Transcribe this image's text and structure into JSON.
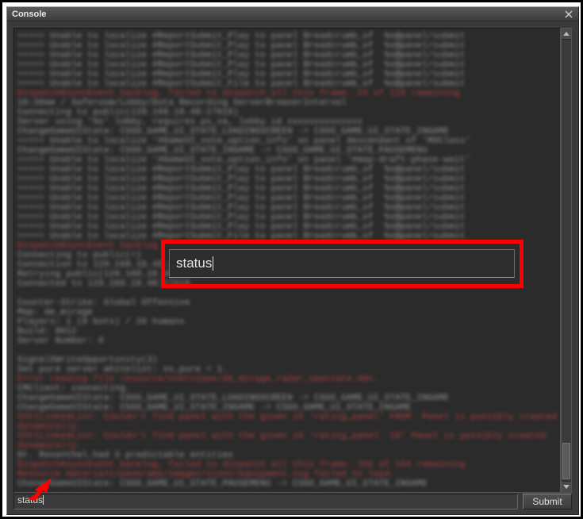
{
  "window": {
    "title": "Console",
    "close_label": "×"
  },
  "highlight": {
    "text": "status"
  },
  "input": {
    "value": "status"
  },
  "submit": {
    "label": "Submit"
  },
  "colors": {
    "highlight_border": "#ff0000",
    "arrow": "#ff0000"
  },
  "log": {
    "lines": [
      {
        "c": "g",
        "t": "===== Unable to localize #ReportSubmit_Play to panel Breadcrumb_of  %s@panel/submit"
      },
      {
        "c": "g",
        "t": "===== Unable to localize #ReportSubmit_Play to panel Breadcrumb_of  %s@panel/submit"
      },
      {
        "c": "g",
        "t": "===== Unable to localize #ReportSubmit_Play to panel Breadcrumb_of  %s@panel/submit"
      },
      {
        "c": "g",
        "t": "===== Unable to localize #ReportSubmit_Play to panel Breadcrumb_of  %s@panel/submit"
      },
      {
        "c": "g",
        "t": "===== Unable to localize #ReportSubmit_Play to panel Breadcrumb_of  %s@panel/submit"
      },
      {
        "c": "g",
        "t": "===== Unable to localize #ReportSubmit_File to panel Breadcrumb_of  %s@panel/submit"
      },
      {
        "c": "r",
        "t": "DispatchAsyncEvent backlog, failed to dispatch all this frame. 24 of 118 remaining"
      },
      {
        "c": "g",
        "t": "10:30am / Saferoom/Lobby/Dota Recording ServerBrowserInterval"
      },
      {
        "c": "g",
        "t": "Connecting to public(129.168.18.48:27018)"
      },
      {
        "c": "g",
        "t": "Server using '%s' lobby, requires ps_va, lobby id xxxxxxxxxxxxxx"
      },
      {
        "c": "g",
        "t": "ChangeGameUIState: CSGO_GAME_UI_STATE_LOADINGSCREEN -> CSGO_GAME_UI_STATE_INGAME"
      },
      {
        "c": "g",
        "t": "===== Unable to localize '#GameUI_vote_option_info' on panel descendant of 'MOClass'"
      },
      {
        "c": "g",
        "t": "ChangeGameUIState: CSGO_GAME_UI_STATE_INGAME -> CSGO_GAME_UI_STATE_PAUSEMENU"
      },
      {
        "c": "g",
        "t": "===== Unable to localize '#GameUI_vote_option_info' on panel '#map-draft-phase-wait'"
      },
      {
        "c": "g",
        "t": "===== Unable to localize #ReportSubmit_Play to panel Breadcrumb_of  %s@panel/submit"
      },
      {
        "c": "g",
        "t": "===== Unable to localize #ReportSubmit_Play to panel Breadcrumb_of  %s@panel/submit"
      },
      {
        "c": "g",
        "t": "===== Unable to localize #ReportSubmit_Play to panel Breadcrumb_of  %s@panel/submit"
      },
      {
        "c": "g",
        "t": "===== Unable to localize #ReportSubmit_Play to panel Breadcrumb_of  %s@panel/submit"
      },
      {
        "c": "g",
        "t": "===== Unable to localize #ReportSubmit_Play to panel Breadcrumb_of  %s@panel/submit"
      },
      {
        "c": "g",
        "t": "===== Unable to localize #ReportSubmit_Play to panel Breadcrumb_of  %s@panel/submit"
      },
      {
        "c": "g",
        "t": "===== Unable to localize #ReportSubmit_Play to panel Breadcrumb_of  %s@panel/submit"
      },
      {
        "c": "g",
        "t": "===== Unable to localize #ReportSubmit_File to panel Breadcrumb_of  %s@panel/submit"
      },
      {
        "c": "r",
        "t": "DispatchAsyncEvent backlog"
      },
      {
        "c": "g",
        "t": "Connecting to public(=)"
      },
      {
        "c": "g",
        "t": "Connection to 129.168.18.48:27018"
      },
      {
        "c": "g",
        "t": "Retrying public(129.168.18.48:27018)..."
      },
      {
        "c": "g",
        "t": "Connected to 129.168.18.48:27018"
      },
      {
        "c": "g",
        "t": " "
      },
      {
        "c": "g",
        "t": "Counter-Strike: Global Offensive"
      },
      {
        "c": "g",
        "t": "Map: de_mirage"
      },
      {
        "c": "g",
        "t": "Players: 1 (0 bots) / 20 humans"
      },
      {
        "c": "g",
        "t": "Build: 8012"
      },
      {
        "c": "g",
        "t": "Server Number: 0"
      },
      {
        "c": "g",
        "t": " "
      },
      {
        "c": "g",
        "t": "SignalXWriteOpportunity(3)"
      },
      {
        "c": "g",
        "t": "Set pure server whitelist: sv_pure = 1."
      },
      {
        "c": "r",
        "t": "Error reading file resource/overviews/de_mirage_radar_spectate.dds."
      },
      {
        "c": "g",
        "t": "CMClient: connecting."
      },
      {
        "c": "g",
        "t": "ChangeGameUIState: CSGO_GAME_UI_STATE_LOADINGSCREEN -> CSGO_GAME_UI_STATE_INGAME"
      },
      {
        "c": "g",
        "t": "ChangeGameUIState: CSGO_GAME_UI_STATE_INGAME -> CSGO_GAME_UI_STATE_INGAME"
      },
      {
        "c": "r",
        "t": "CUtlLinkedList: Couldn't find panel with the given id 'rating_panel' FROM  Panel is possibly created"
      },
      {
        "c": "r",
        "t": "dynamically."
      },
      {
        "c": "r",
        "t": "CUtlLinkedList: Couldn't find panel with the given id 'rating_panel  18' Panel is possibly created"
      },
      {
        "c": "r",
        "t": "dynamically."
      },
      {
        "c": "g",
        "t": "Dr. Rosenthal.had 3 predictable entities"
      },
      {
        "c": "r",
        "t": "DispatchAsyncEvent backlog, failed to dispatch all this frame. 102 of 164 remaining"
      },
      {
        "c": "r",
        "t": "Resource materials/panorama/images/icons/equipment.svg failed to load."
      },
      {
        "c": "g",
        "t": "ChangeGameUIState: CSGO_GAME_UI_STATE_PAUSEMENU -> CSGO_GAME_UI_STATE_INGAME"
      }
    ]
  }
}
